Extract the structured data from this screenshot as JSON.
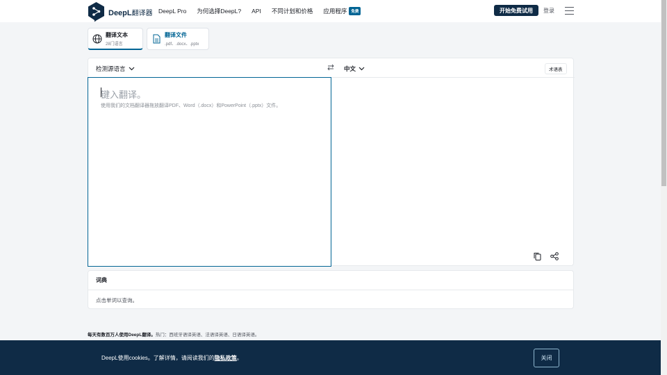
{
  "brand": {
    "name": "DeepL",
    "suffix": "翻译器"
  },
  "nav": {
    "items": [
      {
        "label": "DeepL Pro"
      },
      {
        "label": "为何选择DeepL?"
      },
      {
        "label": "API"
      },
      {
        "label": "不同计划和价格"
      },
      {
        "label": "应用程序",
        "badge": "免费"
      }
    ],
    "cta": "开始免费试用",
    "login": "登录"
  },
  "tabs": [
    {
      "title": "翻译文本",
      "subtitle": "28门语言"
    },
    {
      "title": "翻译文件",
      "subtitle": ".pdf、.docx、.pptx"
    }
  ],
  "translator": {
    "source_lang": "检测源语言",
    "target_lang": "中文",
    "glossary": "术语表",
    "placeholder": "键入翻译。",
    "hint": "使用我们的文档翻译器拖放翻译PDF、Word（.docx）和PowerPoint（.pptx）文件。"
  },
  "dictionary": {
    "title": "词典",
    "hint": "点击单词以查询。"
  },
  "footer": {
    "lead": "每天有数百万人使用DeepL翻译。",
    "popular": "热门：西班牙语译英语、法语译英语、日语译英语。"
  },
  "cookie": {
    "text": "DeepL使用cookies。了解详情，请阅读我们的",
    "link": "隐私政策",
    "end": "。",
    "close": "关闭"
  },
  "colors": {
    "accent": "#006494",
    "navy": "#0f2b46",
    "background": "#f3f5f7"
  }
}
